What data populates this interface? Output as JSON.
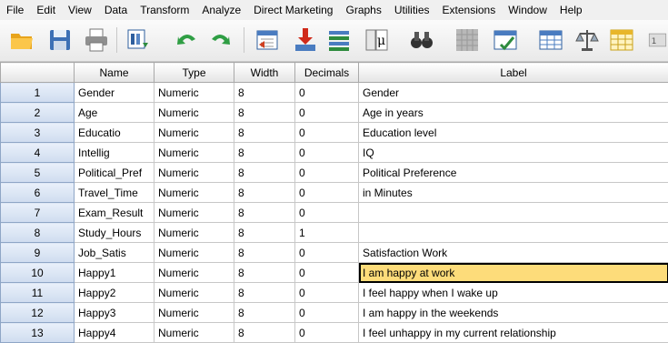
{
  "menu": [
    {
      "label": "File",
      "u": "F",
      "rest": "ile"
    },
    {
      "label": "Edit",
      "u": "E",
      "rest": "dit"
    },
    {
      "label": "View",
      "u": "V",
      "rest": "iew"
    },
    {
      "label": "Data",
      "u": "D",
      "rest": "ata"
    },
    {
      "label": "Transform",
      "u": "T",
      "rest": "ransform"
    },
    {
      "label": "Analyze",
      "u": "A",
      "rest": "nalyze"
    },
    {
      "label": "Direct Marketing",
      "pre": "Direct ",
      "u": "M",
      "rest": "arketing"
    },
    {
      "label": "Graphs",
      "u": "G",
      "rest": "raphs"
    },
    {
      "label": "Utilities",
      "u": "U",
      "rest": "tilities"
    },
    {
      "label": "Extensions",
      "u": "X",
      "pre": "E",
      "rest": "tensions"
    },
    {
      "label": "Window",
      "u": "W",
      "rest": "indow"
    },
    {
      "label": "Help",
      "u": "H",
      "rest": "elp"
    }
  ],
  "toolbar_icons": [
    "open-folder-icon",
    "save-icon",
    "print-icon",
    "recall-dialog-icon",
    "undo-icon",
    "redo-icon",
    "goto-case-icon",
    "goto-variable-icon",
    "variables-icon",
    "run-descriptives-icon",
    "find-icon",
    "insert-cases-icon",
    "insert-variable-icon",
    "split-file-icon",
    "weight-cases-icon",
    "select-cases-icon",
    "value-labels-icon"
  ],
  "columns": [
    "Name",
    "Type",
    "Width",
    "Decimals",
    "Label"
  ],
  "rows": [
    {
      "n": "1",
      "name": "Gender",
      "type": "Numeric",
      "width": "8",
      "dec": "0",
      "label": "Gender"
    },
    {
      "n": "2",
      "name": "Age",
      "type": "Numeric",
      "width": "8",
      "dec": "0",
      "label": "Age in years"
    },
    {
      "n": "3",
      "name": "Educatio",
      "type": "Numeric",
      "width": "8",
      "dec": "0",
      "label": "Education level"
    },
    {
      "n": "4",
      "name": "Intellig",
      "type": "Numeric",
      "width": "8",
      "dec": "0",
      "label": "IQ"
    },
    {
      "n": "5",
      "name": "Political_Pref",
      "type": "Numeric",
      "width": "8",
      "dec": "0",
      "label": "Political Preference"
    },
    {
      "n": "6",
      "name": "Travel_Time",
      "type": "Numeric",
      "width": "8",
      "dec": "0",
      "label": "in Minutes"
    },
    {
      "n": "7",
      "name": "Exam_Result",
      "type": "Numeric",
      "width": "8",
      "dec": "0",
      "label": ""
    },
    {
      "n": "8",
      "name": "Study_Hours",
      "type": "Numeric",
      "width": "8",
      "dec": "1",
      "label": ""
    },
    {
      "n": "9",
      "name": "Job_Satis",
      "type": "Numeric",
      "width": "8",
      "dec": "0",
      "label": "Satisfaction Work"
    },
    {
      "n": "10",
      "name": "Happy1",
      "type": "Numeric",
      "width": "8",
      "dec": "0",
      "label": "I am happy at work"
    },
    {
      "n": "11",
      "name": "Happy2",
      "type": "Numeric",
      "width": "8",
      "dec": "0",
      "label": "I feel happy when I wake up"
    },
    {
      "n": "12",
      "name": "Happy3",
      "type": "Numeric",
      "width": "8",
      "dec": "0",
      "label": "I am happy in the weekends"
    },
    {
      "n": "13",
      "name": "Happy4",
      "type": "Numeric",
      "width": "8",
      "dec": "0",
      "label": "I feel unhappy in my current relationship"
    }
  ],
  "selected_row": "10",
  "selected_column": "Label",
  "colors": {
    "selected_cell": "#fddc7a",
    "row_header": "#d6e2f3"
  }
}
